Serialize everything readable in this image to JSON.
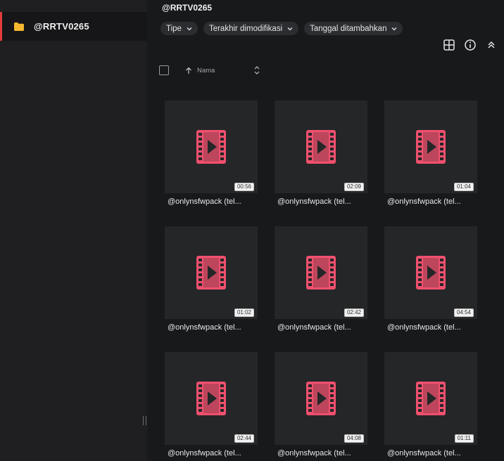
{
  "sidebar": {
    "folder_label": "@RRTV0265",
    "accent_color": "#e23b3b"
  },
  "main": {
    "title": "@RRTV0265",
    "filters": [
      {
        "label": "Tipe"
      },
      {
        "label": "Terakhir dimodifikasi"
      },
      {
        "label": "Tanggal ditambahkan"
      }
    ],
    "toolbar_icons": [
      "grid-view-icon",
      "info-icon",
      "collapse-up-icon"
    ],
    "sort": {
      "label": "Nama",
      "direction": "ascending"
    }
  },
  "files": [
    {
      "name": "@onlynsfwpack (tel...",
      "duration": "00:56"
    },
    {
      "name": "@onlynsfwpack (tel...",
      "duration": "02:09"
    },
    {
      "name": "@onlynsfwpack (tel...",
      "duration": "01:04"
    },
    {
      "name": "@onlynsfwpack (tel...",
      "duration": "01:02"
    },
    {
      "name": "@onlynsfwpack (tel...",
      "duration": "02:42"
    },
    {
      "name": "@onlynsfwpack (tel...",
      "duration": "04:54"
    },
    {
      "name": "@onlynsfwpack (tel...",
      "duration": "02:44"
    },
    {
      "name": "@onlynsfwpack (tel...",
      "duration": "04:08"
    },
    {
      "name": "@onlynsfwpack (tel...",
      "duration": "01:11"
    }
  ],
  "colors": {
    "video_icon": "#f0506e",
    "folder_icon": "#f5b82e"
  }
}
